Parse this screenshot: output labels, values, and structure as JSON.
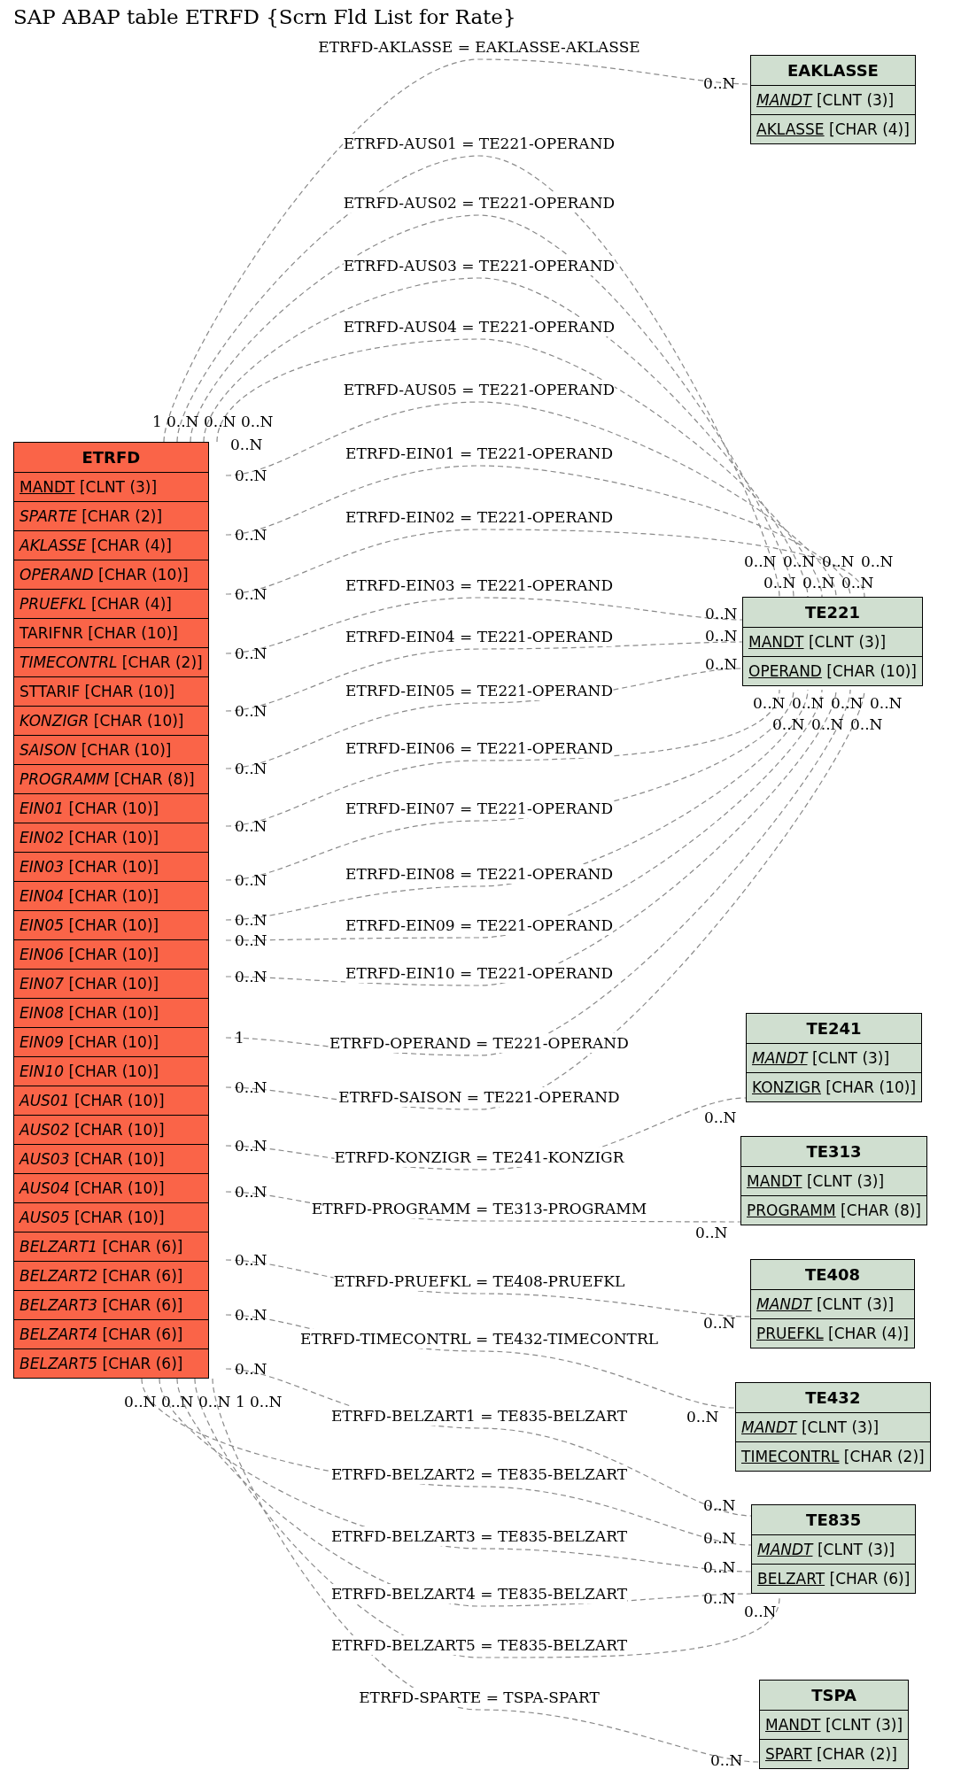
{
  "title": "SAP ABAP table ETRFD {Scrn Fld List for Rate}",
  "tables": [
    {
      "name": "ETRFD",
      "main": true,
      "fields": [
        {
          "name": "MANDT",
          "type": "[CLNT (3)]",
          "key": true,
          "foreign": false
        },
        {
          "name": "SPARTE",
          "type": "[CHAR (2)]",
          "key": false,
          "foreign": true
        },
        {
          "name": "AKLASSE",
          "type": "[CHAR (4)]",
          "key": false,
          "foreign": true
        },
        {
          "name": "OPERAND",
          "type": "[CHAR (10)]",
          "key": false,
          "foreign": true
        },
        {
          "name": "PRUEFKL",
          "type": "[CHAR (4)]",
          "key": false,
          "foreign": true
        },
        {
          "name": "TARIFNR",
          "type": "[CHAR (10)]",
          "key": false,
          "foreign": false
        },
        {
          "name": "TIMECONTRL",
          "type": "[CHAR (2)]",
          "key": false,
          "foreign": true
        },
        {
          "name": "STTARIF",
          "type": "[CHAR (10)]",
          "key": false,
          "foreign": false
        },
        {
          "name": "KONZIGR",
          "type": "[CHAR (10)]",
          "key": false,
          "foreign": true
        },
        {
          "name": "SAISON",
          "type": "[CHAR (10)]",
          "key": false,
          "foreign": true
        },
        {
          "name": "PROGRAMM",
          "type": "[CHAR (8)]",
          "key": false,
          "foreign": true
        },
        {
          "name": "EIN01",
          "type": "[CHAR (10)]",
          "key": false,
          "foreign": true
        },
        {
          "name": "EIN02",
          "type": "[CHAR (10)]",
          "key": false,
          "foreign": true
        },
        {
          "name": "EIN03",
          "type": "[CHAR (10)]",
          "key": false,
          "foreign": true
        },
        {
          "name": "EIN04",
          "type": "[CHAR (10)]",
          "key": false,
          "foreign": true
        },
        {
          "name": "EIN05",
          "type": "[CHAR (10)]",
          "key": false,
          "foreign": true
        },
        {
          "name": "EIN06",
          "type": "[CHAR (10)]",
          "key": false,
          "foreign": true
        },
        {
          "name": "EIN07",
          "type": "[CHAR (10)]",
          "key": false,
          "foreign": true
        },
        {
          "name": "EIN08",
          "type": "[CHAR (10)]",
          "key": false,
          "foreign": true
        },
        {
          "name": "EIN09",
          "type": "[CHAR (10)]",
          "key": false,
          "foreign": true
        },
        {
          "name": "EIN10",
          "type": "[CHAR (10)]",
          "key": false,
          "foreign": true
        },
        {
          "name": "AUS01",
          "type": "[CHAR (10)]",
          "key": false,
          "foreign": true
        },
        {
          "name": "AUS02",
          "type": "[CHAR (10)]",
          "key": false,
          "foreign": true
        },
        {
          "name": "AUS03",
          "type": "[CHAR (10)]",
          "key": false,
          "foreign": true
        },
        {
          "name": "AUS04",
          "type": "[CHAR (10)]",
          "key": false,
          "foreign": true
        },
        {
          "name": "AUS05",
          "type": "[CHAR (10)]",
          "key": false,
          "foreign": true
        },
        {
          "name": "BELZART1",
          "type": "[CHAR (6)]",
          "key": false,
          "foreign": true
        },
        {
          "name": "BELZART2",
          "type": "[CHAR (6)]",
          "key": false,
          "foreign": true
        },
        {
          "name": "BELZART3",
          "type": "[CHAR (6)]",
          "key": false,
          "foreign": true
        },
        {
          "name": "BELZART4",
          "type": "[CHAR (6)]",
          "key": false,
          "foreign": true
        },
        {
          "name": "BELZART5",
          "type": "[CHAR (6)]",
          "key": false,
          "foreign": true
        }
      ]
    },
    {
      "name": "EAKLASSE",
      "main": false,
      "fields": [
        {
          "name": "MANDT",
          "type": "[CLNT (3)]",
          "key": true,
          "foreign": true
        },
        {
          "name": "AKLASSE",
          "type": "[CHAR (4)]",
          "key": true,
          "foreign": false
        }
      ]
    },
    {
      "name": "TE221",
      "main": false,
      "fields": [
        {
          "name": "MANDT",
          "type": "[CLNT (3)]",
          "key": true,
          "foreign": false
        },
        {
          "name": "OPERAND",
          "type": "[CHAR (10)]",
          "key": true,
          "foreign": false
        }
      ]
    },
    {
      "name": "TE241",
      "main": false,
      "fields": [
        {
          "name": "MANDT",
          "type": "[CLNT (3)]",
          "key": true,
          "foreign": true
        },
        {
          "name": "KONZIGR",
          "type": "[CHAR (10)]",
          "key": true,
          "foreign": false
        }
      ]
    },
    {
      "name": "TE313",
      "main": false,
      "fields": [
        {
          "name": "MANDT",
          "type": "[CLNT (3)]",
          "key": true,
          "foreign": false
        },
        {
          "name": "PROGRAMM",
          "type": "[CHAR (8)]",
          "key": true,
          "foreign": false
        }
      ]
    },
    {
      "name": "TE408",
      "main": false,
      "fields": [
        {
          "name": "MANDT",
          "type": "[CLNT (3)]",
          "key": true,
          "foreign": true
        },
        {
          "name": "PRUEFKL",
          "type": "[CHAR (4)]",
          "key": true,
          "foreign": false
        }
      ]
    },
    {
      "name": "TE432",
      "main": false,
      "fields": [
        {
          "name": "MANDT",
          "type": "[CLNT (3)]",
          "key": true,
          "foreign": true
        },
        {
          "name": "TIMECONTRL",
          "type": "[CHAR (2)]",
          "key": true,
          "foreign": false
        }
      ]
    },
    {
      "name": "TE835",
      "main": false,
      "fields": [
        {
          "name": "MANDT",
          "type": "[CLNT (3)]",
          "key": true,
          "foreign": true
        },
        {
          "name": "BELZART",
          "type": "[CHAR (6)]",
          "key": true,
          "foreign": false
        }
      ]
    },
    {
      "name": "TSPA",
      "main": false,
      "fields": [
        {
          "name": "MANDT",
          "type": "[CLNT (3)]",
          "key": true,
          "foreign": false
        },
        {
          "name": "SPART",
          "type": "[CHAR (2)]",
          "key": true,
          "foreign": false
        }
      ]
    }
  ],
  "relations": [
    {
      "label": "ETRFD-AKLASSE = EAKLASSE-AKLASSE",
      "from_card": "1",
      "to_card": "0..N"
    },
    {
      "label": "ETRFD-AUS01 = TE221-OPERAND",
      "from_card": "0..N",
      "to_card": "0..N"
    },
    {
      "label": "ETRFD-AUS02 = TE221-OPERAND",
      "from_card": "0..N",
      "to_card": "0..N"
    },
    {
      "label": "ETRFD-AUS03 = TE221-OPERAND",
      "from_card": "0..N",
      "to_card": "0..N"
    },
    {
      "label": "ETRFD-AUS04 = TE221-OPERAND",
      "from_card": "0..N",
      "to_card": "0..N"
    },
    {
      "label": "ETRFD-AUS05 = TE221-OPERAND",
      "from_card": "0..N",
      "to_card": "0..N"
    },
    {
      "label": "ETRFD-EIN01 = TE221-OPERAND",
      "from_card": "0..N",
      "to_card": "0..N"
    },
    {
      "label": "ETRFD-EIN02 = TE221-OPERAND",
      "from_card": "0..N",
      "to_card": "0..N"
    },
    {
      "label": "ETRFD-EIN03 = TE221-OPERAND",
      "from_card": "0..N",
      "to_card": "0..N"
    },
    {
      "label": "ETRFD-EIN04 = TE221-OPERAND",
      "from_card": "0..N",
      "to_card": "0..N"
    },
    {
      "label": "ETRFD-EIN05 = TE221-OPERAND",
      "from_card": "0..N",
      "to_card": "0..N"
    },
    {
      "label": "ETRFD-EIN06 = TE221-OPERAND",
      "from_card": "0..N",
      "to_card": "0..N"
    },
    {
      "label": "ETRFD-EIN07 = TE221-OPERAND",
      "from_card": "0..N",
      "to_card": "0..N"
    },
    {
      "label": "ETRFD-EIN08 = TE221-OPERAND",
      "from_card": "0..N",
      "to_card": "0..N"
    },
    {
      "label": "ETRFD-EIN09 = TE221-OPERAND",
      "from_card": "0..N",
      "to_card": "0..N"
    },
    {
      "label": "ETRFD-EIN10 = TE221-OPERAND",
      "from_card": "0..N",
      "to_card": "0..N"
    },
    {
      "label": "ETRFD-OPERAND = TE221-OPERAND",
      "from_card": "1",
      "to_card": "0..N"
    },
    {
      "label": "ETRFD-SAISON = TE221-OPERAND",
      "from_card": "0..N",
      "to_card": "0..N"
    },
    {
      "label": "ETRFD-KONZIGR = TE241-KONZIGR",
      "from_card": "0..N",
      "to_card": "0..N"
    },
    {
      "label": "ETRFD-PROGRAMM = TE313-PROGRAMM",
      "from_card": "0..N",
      "to_card": "0..N"
    },
    {
      "label": "ETRFD-PRUEFKL = TE408-PRUEFKL",
      "from_card": "0..N",
      "to_card": "0..N"
    },
    {
      "label": "ETRFD-TIMECONTRL = TE432-TIMECONTRL",
      "from_card": "0..N",
      "to_card": "0..N"
    },
    {
      "label": "ETRFD-BELZART1 = TE835-BELZART",
      "from_card": "0..N",
      "to_card": "0..N"
    },
    {
      "label": "ETRFD-BELZART2 = TE835-BELZART",
      "from_card": "0..N",
      "to_card": "0..N"
    },
    {
      "label": "ETRFD-BELZART3 = TE835-BELZART",
      "from_card": "0..N",
      "to_card": "0..N"
    },
    {
      "label": "ETRFD-BELZART4 = TE835-BELZART",
      "from_card": "0..N",
      "to_card": "0..N"
    },
    {
      "label": "ETRFD-BELZART5 = TE835-BELZART",
      "from_card": "1",
      "to_card": "0..N"
    },
    {
      "label": "ETRFD-SPARTE = TSPA-SPART",
      "from_card": "0..N",
      "to_card": "0..N"
    }
  ]
}
